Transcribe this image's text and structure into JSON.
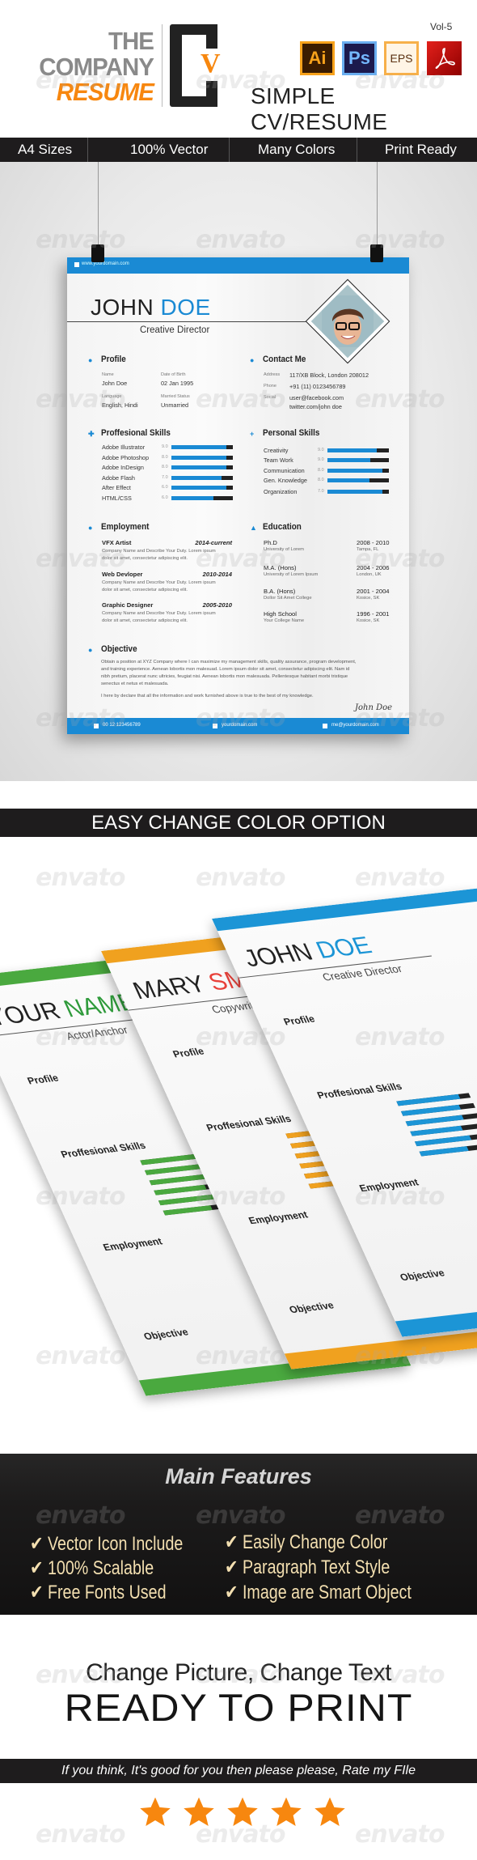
{
  "header": {
    "title_line1": "THE",
    "title_line2": "COMPANY",
    "title_line3": "RESUME",
    "logo_letters": "CV",
    "logo_v": "V",
    "volume": "Vol-5",
    "software_icons": [
      {
        "label": "Ai",
        "name": "illustrator-icon"
      },
      {
        "label": "Ps",
        "name": "photoshop-icon"
      },
      {
        "label": "EPS",
        "name": "eps-icon"
      },
      {
        "label": "",
        "name": "acrobat-pdf-icon"
      }
    ],
    "subtitle": "SIMPLE CV/RESUME"
  },
  "feature_bar": [
    "A4 Sizes",
    "100% Vector",
    "Many Colors",
    "Print Ready"
  ],
  "resume": {
    "website": "www.yourdomain.com",
    "first_name": "JOHN",
    "last_name": "DOE",
    "job_title": "Creative Director",
    "profile": {
      "heading": "Profile",
      "fields": [
        {
          "label": "Name",
          "value": "John Doe"
        },
        {
          "label": "Date of Birth",
          "value": "02 Jan 1995"
        },
        {
          "label": "Language",
          "value": "English, Hindi"
        },
        {
          "label": "Married Status",
          "value": "Unmarried"
        }
      ]
    },
    "contact": {
      "heading": "Contact Me",
      "address_label": "Address",
      "address": "117/XB Block,  London 208012",
      "phone_label": "Phone",
      "phone": "+91 (11) 0123456789",
      "social_label": "Social",
      "social1": "user@facebook.com",
      "social2": "twitter.com/john doe"
    },
    "professional_skills": {
      "heading": "Proffesional Skills",
      "items": [
        {
          "name": "Adobe Illustrator",
          "score": "9.0",
          "level": 0.9
        },
        {
          "name": "Adobe Photoshop",
          "score": "8.0",
          "level": 0.9
        },
        {
          "name": "Adobe InDesign",
          "score": "8.0",
          "level": 0.9
        },
        {
          "name": "Adobe Flash",
          "score": "7.0",
          "level": 0.81
        },
        {
          "name": "After Effect",
          "score": "6.0",
          "level": 0.9
        },
        {
          "name": "HTML/CSS",
          "score": "6.0",
          "level": 0.69
        }
      ]
    },
    "personal_skills": {
      "heading": "Personal Skills",
      "items": [
        {
          "name": "Creativity",
          "score": "9.0",
          "level": 0.8
        },
        {
          "name": "Team Work",
          "score": "9.0",
          "level": 0.7
        },
        {
          "name": "Communication",
          "score": "8.0",
          "level": 0.9
        },
        {
          "name": "Gen. Knowledge",
          "score": "8.0",
          "level": 0.68
        },
        {
          "name": "Organization",
          "score": "7.0",
          "level": 0.9
        }
      ]
    },
    "employment": {
      "heading": "Employment",
      "items": [
        {
          "title": "VFX Artist",
          "date": "2014-current",
          "desc1": "Company Name and Describe Your Duty. Lorem ipsum",
          "desc2": "dolor sit amet, consectetur adipiscing elit."
        },
        {
          "title": "Web Devloper",
          "date": "2010-2014",
          "desc1": "Company Name and Describe Your Duty. Lorem ipsum",
          "desc2": "dolor sit amet, consectetur adipiscing elit."
        },
        {
          "title": "Graphic Designer",
          "date": "2005-2010",
          "desc1": "Company Name and Describe Your Duty. Lorem ipsum",
          "desc2": "dolor sit amet, consectetur adipiscing elit."
        }
      ]
    },
    "education": {
      "heading": "Education",
      "items": [
        {
          "degree": "Ph.D",
          "school": "University of Lorem",
          "years": "2008 - 2010",
          "place": "Tampa, FL"
        },
        {
          "degree": "M.A. (Hons)",
          "school": "University of Lorem Ipsum",
          "years": "2004 - 2006",
          "place": "London, UK"
        },
        {
          "degree": "B.A. (Hons)",
          "school": "Dollor Sit Amet College",
          "years": "2001 - 2004",
          "place": "Kosice, SK"
        },
        {
          "degree": "High School",
          "school": "Your College Name",
          "years": "1996 - 2001",
          "place": "Kosice, SK"
        }
      ]
    },
    "objective": {
      "heading": "Objective",
      "lines": [
        "Obtain a position at XYZ Company where I can maximize my management skills, quality assurance, program development,",
        "and training experience. Aenean lobortis mon malesuad. Lorem ipsum dolor sit amet, consectetur adipiscing elit. Nam id",
        "nibh pretium, placerat nunc ultricies, feugiat nisi. Aenean lobortis mon malesuada. Pellentesque habitant morbi tristique",
        "senectus et netus et malesuada."
      ],
      "declaration": "I here by declare that all the information and work furnished above is true to the best of my knowledge.",
      "signature": "John Doe"
    },
    "footer": {
      "phone": "00 12 123456789",
      "website": "yourdomain.com",
      "email": "me@yourdomain.com"
    }
  },
  "color_section": {
    "title": "EASY CHANGE COLOR OPTION",
    "variants": [
      {
        "color": "#4aa93f",
        "first": "YOUR",
        "last": "NAME",
        "role": "Actor/Anchor",
        "accent_name": "#2e9a3a"
      },
      {
        "color": "#f0a11f",
        "first": "MARY",
        "last": "SMITH",
        "role": "Copywriter",
        "accent_name": "#e8413a"
      },
      {
        "color": "#1c95d6",
        "first": "JOHN",
        "last": "DOE",
        "role": "Creative Director",
        "accent_name": "#1c95d6"
      }
    ],
    "labels": {
      "profile": "Profile",
      "skills": "Proffesional Skills",
      "employment": "Employment",
      "objective": "Objective",
      "contact": "Contact Me",
      "personal": "Personal Skills"
    }
  },
  "main_features": {
    "title": "Main Features",
    "items": [
      "Vector Icon Include",
      "100% Scalable",
      "Free Fonts Used",
      "Easily Change Color",
      "Paragraph Text Style",
      "Image are Smart Object"
    ]
  },
  "ready": {
    "line1": "Change Picture, Change Text",
    "line2": "READY TO PRINT"
  },
  "rate": {
    "text": "If you think, It's good for you then please please, Rate my FIle",
    "stars": 5,
    "star_color": "#f7870f"
  },
  "watermark": "envato",
  "colors": {
    "accent_orange": "#f7870f",
    "resume_blue": "#1a8ad4",
    "dark_bar": "#1e1c1d",
    "feature_text": "#f3dfb0"
  }
}
